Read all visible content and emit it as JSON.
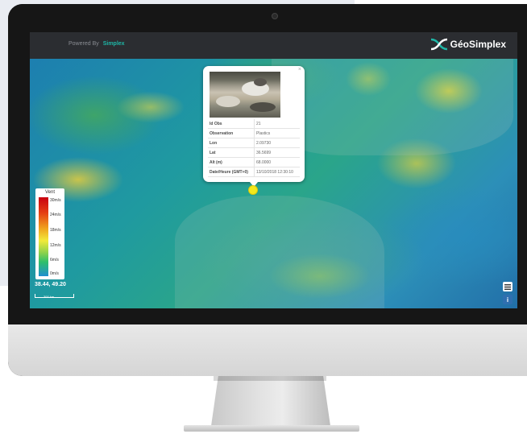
{
  "header": {
    "powered_by": "Powered By",
    "powered_brand": "Simplex",
    "logo_text": "GéoSimplex",
    "logo_sub": "Simplex"
  },
  "legend": {
    "title": "Vent",
    "ticks": [
      "30m/s",
      "24m/s",
      "18m/s",
      "12m/s",
      "6m/s",
      "0m/s"
    ]
  },
  "map": {
    "coords": "38.44, 49.20",
    "scale": "300 km"
  },
  "popup": {
    "close_label": "×",
    "rows": [
      {
        "key": "Id Obs",
        "value": "21"
      },
      {
        "key": "Observation",
        "value": "Plastics"
      },
      {
        "key": "Lon",
        "value": "2.09730"
      },
      {
        "key": "Lat",
        "value": "36.5699"
      },
      {
        "key": "Alt (m)",
        "value": "68.0000"
      },
      {
        "key": "Date/Heure (GMT+0)",
        "value": "13/10/2018 12:30:10"
      }
    ]
  },
  "buttons": {
    "info_label": "i"
  },
  "colors": {
    "accent": "#1fb6a6",
    "marker": "#f3e81c",
    "info_button": "#2f6fb0"
  }
}
